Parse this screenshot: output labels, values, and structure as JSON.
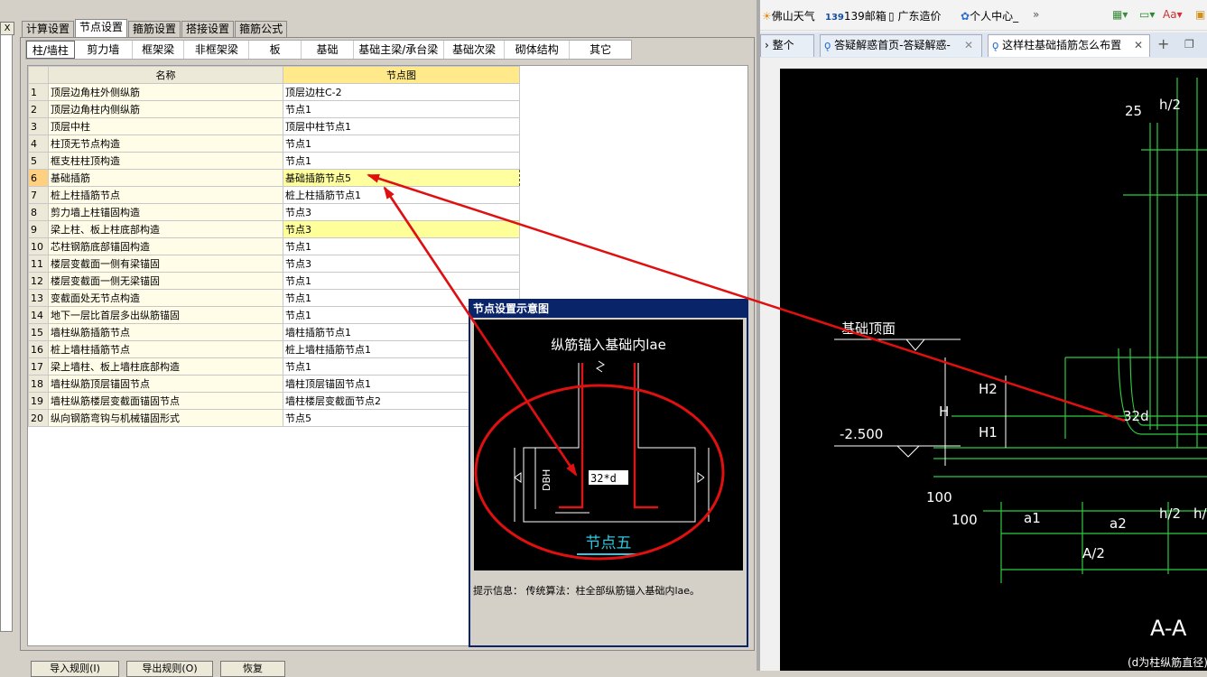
{
  "left_panel": {
    "close_glyph": "X",
    "top_tabs": [
      "计算设置",
      "节点设置",
      "箍筋设置",
      "搭接设置",
      "箍筋公式"
    ],
    "active_top_tab": 1,
    "sub_tabs": [
      "柱/墙柱",
      "剪力墙",
      "框架梁",
      "非框架梁",
      "板",
      "基础",
      "基础主梁/承台梁",
      "基础次梁",
      "砌体结构",
      "其它"
    ],
    "active_sub_tab": 0,
    "grid_headers": {
      "name": "名称",
      "node": "节点图"
    },
    "rows": [
      {
        "no": "1",
        "name": "顶层边角柱外侧纵筋",
        "value": "顶层边柱C-2"
      },
      {
        "no": "2",
        "name": "顶层边角柱内侧纵筋",
        "value": "节点1"
      },
      {
        "no": "3",
        "name": "顶层中柱",
        "value": "顶层中柱节点1"
      },
      {
        "no": "4",
        "name": "柱顶无节点构造",
        "value": "节点1"
      },
      {
        "no": "5",
        "name": "框支柱柱顶构造",
        "value": "节点1"
      },
      {
        "no": "6",
        "name": "基础插筋",
        "value": "基础插筋节点5"
      },
      {
        "no": "7",
        "name": "桩上柱插筋节点",
        "value": "桩上柱插筋节点1"
      },
      {
        "no": "8",
        "name": "剪力墙上柱锚固构造",
        "value": "节点3"
      },
      {
        "no": "9",
        "name": "梁上柱、板上柱底部构造",
        "value": "节点3"
      },
      {
        "no": "10",
        "name": "芯柱钢筋底部锚固构造",
        "value": "节点1"
      },
      {
        "no": "11",
        "name": "楼层变截面一侧有梁锚固",
        "value": "节点3"
      },
      {
        "no": "12",
        "name": "楼层变截面一侧无梁锚固",
        "value": "节点1"
      },
      {
        "no": "13",
        "name": "变截面处无节点构造",
        "value": "节点1"
      },
      {
        "no": "14",
        "name": "地下一层比首层多出纵筋锚固",
        "value": "节点1"
      },
      {
        "no": "15",
        "name": "墙柱纵筋插筋节点",
        "value": "墙柱插筋节点1"
      },
      {
        "no": "16",
        "name": "桩上墙柱插筋节点",
        "value": "桩上墙柱插筋节点1"
      },
      {
        "no": "17",
        "name": "梁上墙柱、板上墙柱底部构造",
        "value": "节点1"
      },
      {
        "no": "18",
        "name": "墙柱纵筋顶层锚固节点",
        "value": "墙柱顶层锚固节点1"
      },
      {
        "no": "19",
        "name": "墙柱纵筋楼层变截面锚固节点",
        "value": "墙柱楼层变截面节点2"
      },
      {
        "no": "20",
        "name": "纵向钢筋弯钩与机械锚固形式",
        "value": "节点5"
      }
    ],
    "bottom_buttons": [
      "导入规则(I)",
      "导出规则(O)",
      "恢复"
    ]
  },
  "dialog": {
    "title": "节点设置示意图",
    "caption": "纵筋锚入基础内lae",
    "dbh_label": "DBH",
    "input_value": "32*d",
    "node_name": "节点五",
    "tip": "提示信息： 传统算法：柱全部纵筋锚入基础内lae。"
  },
  "browser": {
    "favorites": [
      "佛山天气",
      "139邮箱",
      "广东造价",
      "个人中心_"
    ],
    "fav_more": "»",
    "tabs": [
      "整个",
      "答疑解惑首页-答疑解惑-",
      "这样柱基础插筋怎么布置"
    ],
    "new_tab": "+",
    "cad": {
      "labels": [
        "25",
        "h/2",
        "基础顶面",
        "-2.500",
        "H",
        "H2",
        "H1",
        "32d",
        "100",
        "100",
        "a1",
        "a2",
        "h/2",
        "h/",
        "A/2",
        "A-A",
        "(d为柱纵筋直径)"
      ]
    }
  },
  "colors": {
    "annotation_red": "#e01010",
    "selected_row": "#ffffa0",
    "dialog_title": "#0a246a"
  }
}
